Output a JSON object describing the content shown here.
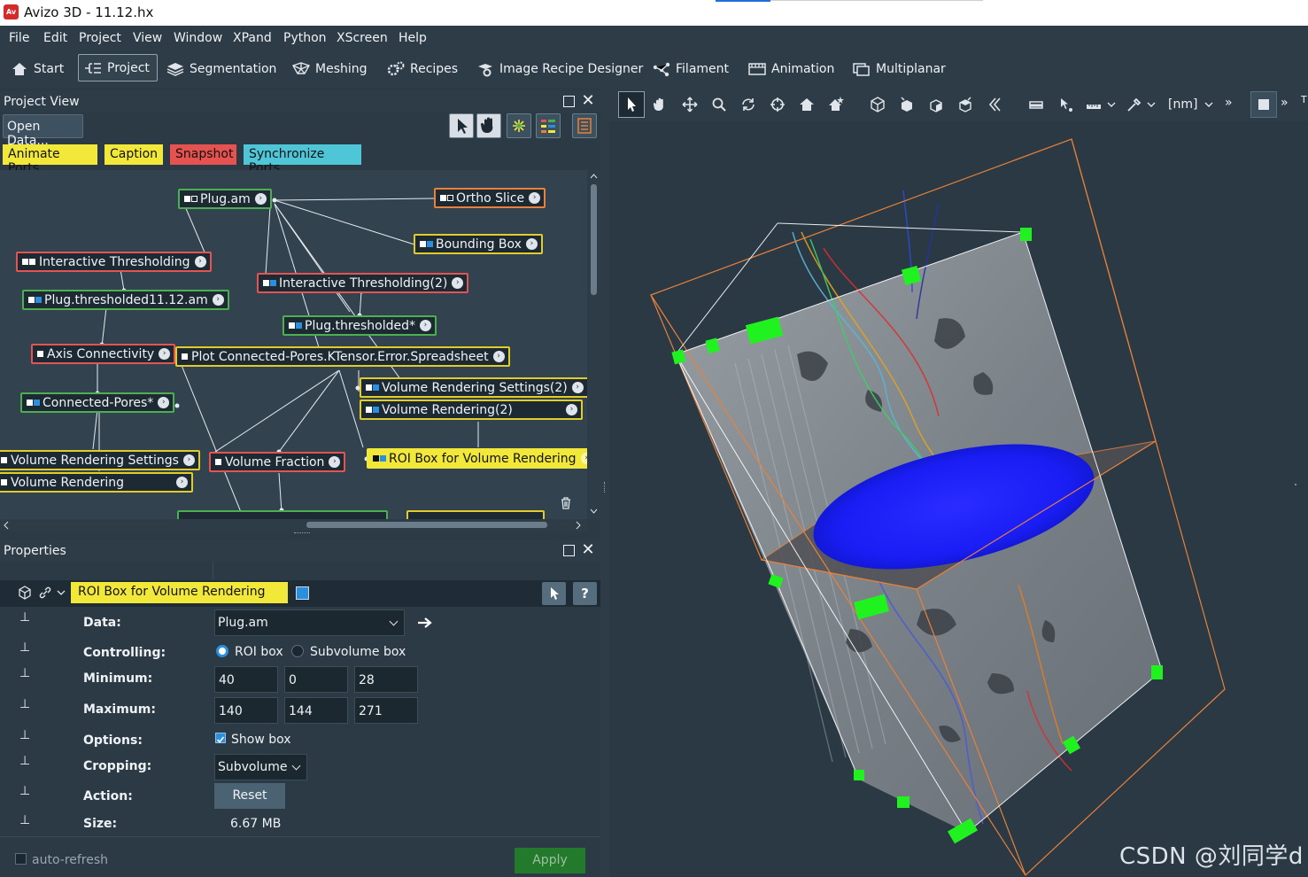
{
  "window": {
    "title": "Avizo 3D - 11.12.hx",
    "logo": "Av"
  },
  "menu": [
    "File",
    "Edit",
    "Project",
    "View",
    "Window",
    "XPand",
    "Python",
    "XScreen",
    "Help"
  ],
  "toolbar": {
    "start": "Start",
    "project": "Project",
    "segmentation": "Segmentation",
    "meshing": "Meshing",
    "recipes": "Recipes",
    "image_recipe_designer": "Image Recipe Designer",
    "filament": "Filament",
    "animation": "Animation",
    "multiplanar": "Multiplanar"
  },
  "project_view": {
    "title": "Project View",
    "open_data": "Open Data...",
    "quick_buttons": {
      "animate_ports": "Animate Ports",
      "caption": "Caption",
      "snapshot": "Snapshot",
      "synchronize_ports": "Synchronize Ports"
    },
    "nodes": {
      "plug_am": "Plug.am",
      "ortho_slice": "Ortho Slice",
      "bounding_box": "Bounding Box",
      "interactive_thresholding": "Interactive Thresholding",
      "interactive_thresholding_2": "Interactive Thresholding(2)",
      "plug_thresholded_1112": "Plug.thresholded11.12.am",
      "plug_thresholded": "Plug.thresholded*",
      "axis_connectivity": "Axis Connectivity",
      "plot_spreadsheet": "Plot Connected-Pores.KTensor.Error.Spreadsheet",
      "volume_rendering_settings_2": "Volume Rendering Settings(2)",
      "volume_rendering_2": "Volume Rendering(2)",
      "connected_pores": "Connected-Pores*",
      "roi_box": "ROI Box for Volume Rendering",
      "volume_rendering_settings": "Volume Rendering Settings",
      "volume_fraction": "Volume Fraction",
      "volume_rendering": "Volume Rendering"
    }
  },
  "properties": {
    "title": "Properties",
    "module_name": "ROI Box for Volume Rendering",
    "help_label": "?",
    "labels": {
      "data": "Data:",
      "controlling": "Controlling:",
      "minimum": "Minimum:",
      "maximum": "Maximum:",
      "options": "Options:",
      "cropping": "Cropping:",
      "action": "Action:",
      "size": "Size:"
    },
    "data_value": "Plug.am",
    "controlling_options": [
      "ROI box",
      "Subvolume box"
    ],
    "minimum": [
      "40",
      "0",
      "28"
    ],
    "maximum": [
      "140",
      "144",
      "271"
    ],
    "show_box": "Show box",
    "cropping_value": "Subvolume",
    "reset": "Reset",
    "size_value": "6.67 MB",
    "auto_refresh": "auto-refresh",
    "apply": "Apply"
  },
  "viewer": {
    "unit": "[nm]",
    "more": "»",
    "top_label": "T"
  },
  "watermark": "CSDN @刘同学d",
  "colors": {
    "node_green": "#4caf50",
    "node_red": "#e25555",
    "node_yellow": "#e0cc2b",
    "node_orange": "#e8813a",
    "selected_module": "#f2e83a",
    "apply_green": "#247a2c",
    "viewer_bg": "#2a3943"
  }
}
